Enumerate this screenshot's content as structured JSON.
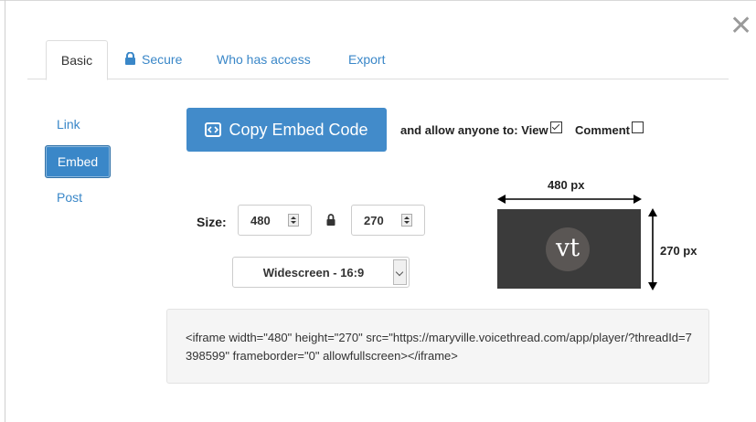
{
  "dialog": {
    "close_glyph": "✕"
  },
  "tabs": [
    {
      "label": "Basic",
      "active": true
    },
    {
      "label": "Secure",
      "icon": "lock-icon",
      "active": false
    },
    {
      "label": "Who has access",
      "active": false
    },
    {
      "label": "Export",
      "active": false
    }
  ],
  "sidebar": {
    "items": [
      {
        "label": "Link",
        "active": false
      },
      {
        "label": "Embed",
        "active": true
      },
      {
        "label": "Post",
        "active": false
      }
    ]
  },
  "embed": {
    "copy_button_label": "Copy Embed Code",
    "allow_label": "and allow anyone to:",
    "view_label": "View",
    "view_checked": true,
    "comment_label": "Comment",
    "comment_checked": false,
    "size_label": "Size:",
    "width_value": "480",
    "height_value": "270",
    "aspect_selected": "Widescreen - 16:9",
    "preview_width_label": "480 px",
    "preview_height_label": "270 px",
    "logo_text": "vt",
    "code": "<iframe width=\"480\" height=\"270\" src=\"https://maryville.voicethread.com/app/player/?threadId=7398599\" frameborder=\"0\" allowfullscreen></iframe>"
  },
  "colors": {
    "accent": "#428bca",
    "link": "#3a87c8",
    "thumb_bg": "#3b3b3b"
  }
}
